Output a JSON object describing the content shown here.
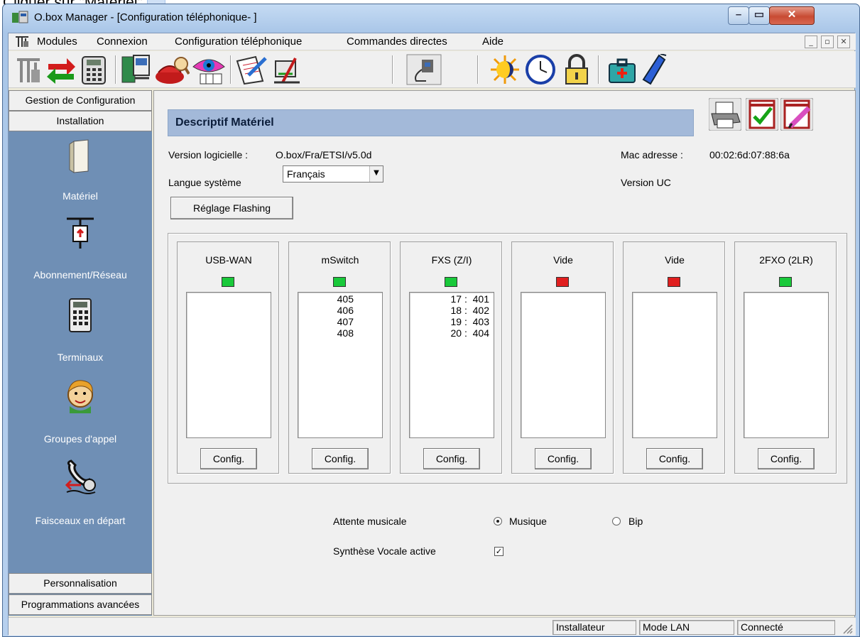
{
  "caption": {
    "text": "Cliquer sur \"Matériel\""
  },
  "window": {
    "title": "O.box Manager - [Configuration téléphonique- ]",
    "min": "–",
    "max": "▭",
    "close": "✕"
  },
  "menu": {
    "items": [
      "Modules",
      "Connexion",
      "Configuration téléphonique",
      "Commandes directes",
      "Aide"
    ],
    "mdi": [
      "_",
      "▫",
      "✕"
    ]
  },
  "toolbar": {
    "icons": [
      "antenna-icon",
      "sync-arrows-icon",
      "phone-keypad-icon",
      "network-terminal-icon",
      "red-phone-icon",
      "eye-directory-icon",
      "notepad-icon",
      "tools-icon",
      "connector-icon",
      "day-night-icon",
      "clock-icon",
      "padlock-icon",
      "medical-kit-icon",
      "mobile-phone-icon"
    ]
  },
  "nav": {
    "top_tabs": [
      "Gestion de Configuration",
      "Installation"
    ],
    "tiles": [
      {
        "label": "Matériel",
        "icon": "hardware-box-icon"
      },
      {
        "label": "Abonnement/Réseau",
        "icon": "network-plug-icon"
      },
      {
        "label": "Terminaux",
        "icon": "desk-phone-icon"
      },
      {
        "label": "Groupes d'appel",
        "icon": "operator-face-icon"
      },
      {
        "label": "Faisceaux en départ",
        "icon": "outgoing-handset-icon"
      }
    ],
    "bottom_tabs": [
      "Personnalisation",
      "Programmations avancées"
    ]
  },
  "main": {
    "header": "Descriptif Matériel",
    "version_label": "Version logicielle :",
    "version_value": "O.box/Fra/ETSI/v5.0d",
    "mac_label": "Mac adresse :",
    "mac_value": "00:02:6d:07:88:6a",
    "lang_label": "Langue système",
    "lang_value": "Français",
    "uc_label": "Version UC",
    "flash_button": "Réglage Flashing",
    "config_label": "Config.",
    "cards": [
      {
        "title": "USB-WAN",
        "status": "green",
        "entries": []
      },
      {
        "title": "mSwitch",
        "status": "green",
        "entries": [
          "405",
          "406",
          "407",
          "408"
        ]
      },
      {
        "title": "FXS (Z/I)",
        "status": "green",
        "entries": [
          "17 :  401",
          "18 :  402",
          "19 :  403",
          "20 :  404"
        ]
      },
      {
        "title": "Vide",
        "status": "red",
        "entries": []
      },
      {
        "title": "Vide",
        "status": "red",
        "entries": []
      },
      {
        "title": "2FXO (2LR)",
        "status": "green",
        "entries": []
      }
    ],
    "moh_label": "Attente musicale",
    "moh_options": [
      {
        "label": "Musique",
        "selected": true
      },
      {
        "label": "Bip",
        "selected": false
      }
    ],
    "tts_label": "Synthèse Vocale active",
    "tts_checked": true,
    "tts_mark": "✓"
  },
  "status": {
    "fields": [
      "Installateur",
      "Mode LAN",
      "Connecté"
    ]
  },
  "colors": {
    "led_green": "#19c93a",
    "led_red": "#e01f1f",
    "nav_bg": "#6f8fb5",
    "header_bg": "#a3b9d9"
  }
}
